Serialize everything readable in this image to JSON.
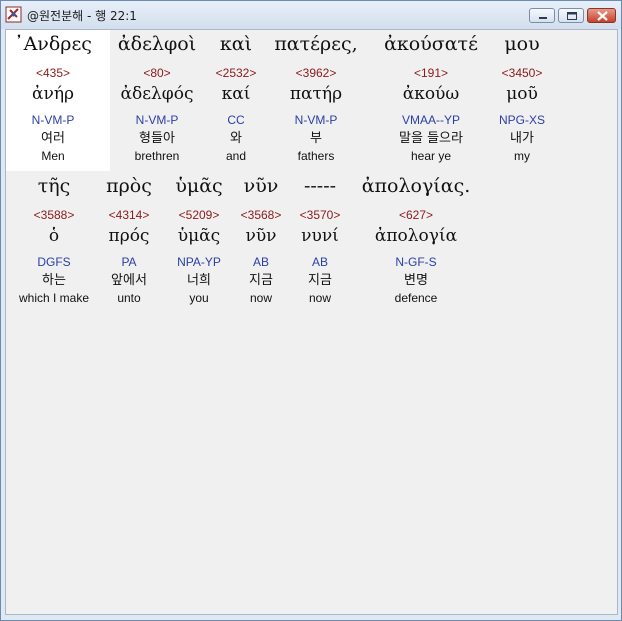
{
  "window": {
    "title": "@원전분해 - 행 22:1"
  },
  "rows": [
    [
      {
        "greek": "᾿Ανδρες",
        "strong": "<435>",
        "lemma": "ἀνήρ",
        "morph": "N-VM-P",
        "korean": "여러",
        "english": "Men"
      },
      {
        "greek": "ἀδελφοὶ",
        "strong": "<80>",
        "lemma": "ἀδελφός",
        "morph": "N-VM-P",
        "korean": "형들아",
        "english": "brethren"
      },
      {
        "greek": "καὶ",
        "strong": "<2532>",
        "lemma": "καί",
        "morph": "CC",
        "korean": "와",
        "english": "and"
      },
      {
        "greek": "πατέρες,",
        "strong": "<3962>",
        "lemma": "πατήρ",
        "morph": "N-VM-P",
        "korean": "부",
        "english": "fathers"
      },
      {
        "greek": "ἀκούσατέ",
        "strong": "<191>",
        "lemma": "ἀκούω",
        "morph": "VMAA--YP",
        "korean": "말을 들으라",
        "english": "hear ye"
      },
      {
        "greek": "μου",
        "strong": "<3450>",
        "lemma": "μοῦ",
        "morph": "NPG-XS",
        "korean": "내가",
        "english": "my"
      }
    ],
    [
      {
        "greek": "τῆς",
        "strong": "<3588>",
        "lemma": "ὁ",
        "morph": "DGFS",
        "korean": "하는",
        "english": "which I make"
      },
      {
        "greek": "πρὸς",
        "strong": "<4314>",
        "lemma": "πρός",
        "morph": "PA",
        "korean": "앞에서",
        "english": "unto"
      },
      {
        "greek": "ὑμᾶς",
        "strong": "<5209>",
        "lemma": "ὑμᾶς",
        "morph": "NPA-YP",
        "korean": "너희",
        "english": "you"
      },
      {
        "greek": "νῦν",
        "strong": "<3568>",
        "lemma": "νῦν",
        "morph": "AB",
        "korean": "지금",
        "english": "now"
      },
      {
        "greek": "-----",
        "strong": "<3570>",
        "lemma": "νυνί",
        "morph": "AB",
        "korean": "지금",
        "english": "now"
      },
      {
        "greek": "ἀπολογίας.",
        "strong": "<627>",
        "lemma": "ἀπολογία",
        "morph": "N-GF-S",
        "korean": "변명",
        "english": "defence"
      }
    ]
  ],
  "colors": {
    "strong": "#8b1a1a",
    "morph": "#2a3fa6",
    "highlight": "#ffffff",
    "background": "#f0f0f0"
  }
}
